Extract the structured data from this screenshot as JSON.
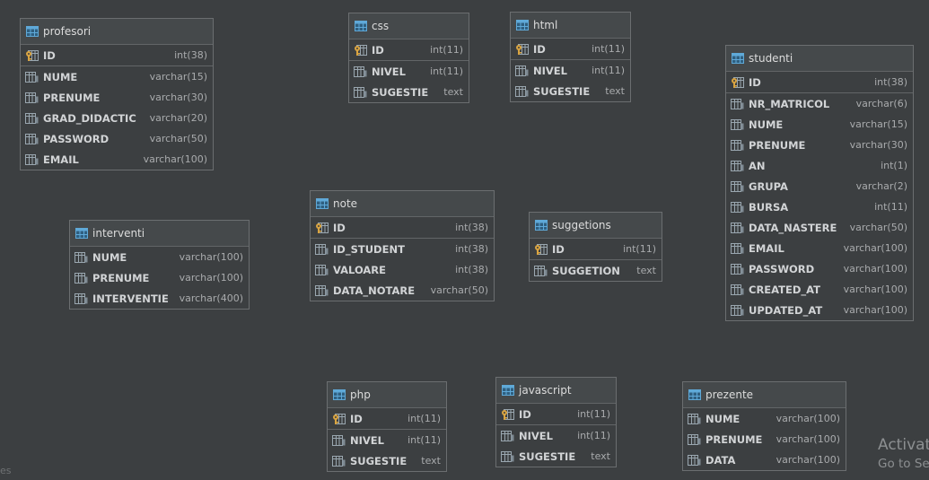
{
  "tables": [
    {
      "id": "profesori",
      "name": "profesori",
      "columns": [
        {
          "name": "ID",
          "type": "int(38)",
          "pk": true
        },
        {
          "name": "NUME",
          "type": "varchar(15)"
        },
        {
          "name": "PRENUME",
          "type": "varchar(30)"
        },
        {
          "name": "GRAD_DIDACTIC",
          "type": "varchar(20)"
        },
        {
          "name": "PASSWORD",
          "type": "varchar(50)"
        },
        {
          "name": "EMAIL",
          "type": "varchar(100)"
        }
      ]
    },
    {
      "id": "css",
      "name": "css",
      "columns": [
        {
          "name": "ID",
          "type": "int(11)",
          "pk": true
        },
        {
          "name": "NIVEL",
          "type": "int(11)"
        },
        {
          "name": "SUGESTIE",
          "type": "text"
        }
      ]
    },
    {
      "id": "html",
      "name": "html",
      "columns": [
        {
          "name": "ID",
          "type": "int(11)",
          "pk": true
        },
        {
          "name": "NIVEL",
          "type": "int(11)"
        },
        {
          "name": "SUGESTIE",
          "type": "text"
        }
      ]
    },
    {
      "id": "studenti",
      "name": "studenti",
      "columns": [
        {
          "name": "ID",
          "type": "int(38)",
          "pk": true
        },
        {
          "name": "NR_MATRICOL",
          "type": "varchar(6)"
        },
        {
          "name": "NUME",
          "type": "varchar(15)"
        },
        {
          "name": "PRENUME",
          "type": "varchar(30)"
        },
        {
          "name": "AN",
          "type": "int(1)"
        },
        {
          "name": "GRUPA",
          "type": "varchar(2)"
        },
        {
          "name": "BURSA",
          "type": "int(11)"
        },
        {
          "name": "DATA_NASTERE",
          "type": "varchar(50)"
        },
        {
          "name": "EMAIL",
          "type": "varchar(100)"
        },
        {
          "name": "PASSWORD",
          "type": "varchar(100)"
        },
        {
          "name": "CREATED_AT",
          "type": "varchar(100)"
        },
        {
          "name": "UPDATED_AT",
          "type": "varchar(100)"
        }
      ]
    },
    {
      "id": "interventi",
      "name": "interventi",
      "columns": [
        {
          "name": "NUME",
          "type": "varchar(100)"
        },
        {
          "name": "PRENUME",
          "type": "varchar(100)"
        },
        {
          "name": "INTERVENTIE",
          "type": "varchar(400)"
        }
      ]
    },
    {
      "id": "note",
      "name": "note",
      "columns": [
        {
          "name": "ID",
          "type": "int(38)",
          "pk": true
        },
        {
          "name": "ID_STUDENT",
          "type": "int(38)"
        },
        {
          "name": "VALOARE",
          "type": "int(38)"
        },
        {
          "name": "DATA_NOTARE",
          "type": "varchar(50)"
        }
      ]
    },
    {
      "id": "suggetions",
      "name": "suggetions",
      "columns": [
        {
          "name": "ID",
          "type": "int(11)",
          "pk": true
        },
        {
          "name": "SUGGETION",
          "type": "text"
        }
      ]
    },
    {
      "id": "php",
      "name": "php",
      "columns": [
        {
          "name": "ID",
          "type": "int(11)",
          "pk": true
        },
        {
          "name": "NIVEL",
          "type": "int(11)"
        },
        {
          "name": "SUGESTIE",
          "type": "text"
        }
      ]
    },
    {
      "id": "javascript",
      "name": "javascript",
      "columns": [
        {
          "name": "ID",
          "type": "int(11)",
          "pk": true
        },
        {
          "name": "NIVEL",
          "type": "int(11)"
        },
        {
          "name": "SUGESTIE",
          "type": "text"
        }
      ]
    },
    {
      "id": "prezente",
      "name": "prezente",
      "columns": [
        {
          "name": "NUME",
          "type": "varchar(100)"
        },
        {
          "name": "PRENUME",
          "type": "varchar(100)"
        },
        {
          "name": "DATA",
          "type": "varchar(100)"
        }
      ]
    }
  ],
  "watermark": {
    "line1": "Activat",
    "line2": "Go to Se"
  },
  "edge_text": "es",
  "colors": {
    "background": "#3c3f41",
    "table_icon": "#5fa9d8",
    "key_icon": "#d9a441",
    "column_icon": "#9aa7b0"
  }
}
